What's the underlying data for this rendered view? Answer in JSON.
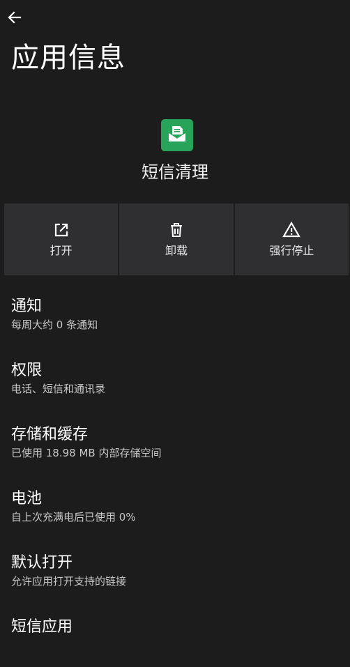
{
  "header": {
    "back_icon": "arrow-left-icon",
    "title": "应用信息"
  },
  "app": {
    "icon": "sms-envelope-icon",
    "icon_color": "#27a35a",
    "name": "短信清理"
  },
  "actions": [
    {
      "label": "打开",
      "icon": "open-external-icon"
    },
    {
      "label": "卸载",
      "icon": "trash-icon"
    },
    {
      "label": "强行停止",
      "icon": "warning-triangle-icon"
    }
  ],
  "settings": [
    {
      "title": "通知",
      "subtitle": "每周大约 0 条通知"
    },
    {
      "title": "权限",
      "subtitle": "电话、短信和通讯录"
    },
    {
      "title": "存储和缓存",
      "subtitle": "已使用 18.98 MB 内部存储空间"
    },
    {
      "title": "电池",
      "subtitle": "自上次充满电后已使用 0%"
    },
    {
      "title": "默认打开",
      "subtitle": "允许应用打开支持的链接"
    },
    {
      "title": "短信应用",
      "subtitle": ""
    }
  ],
  "colors": {
    "background": "#1c1c1c",
    "card": "#2f2f31",
    "accent": "#27a35a"
  }
}
